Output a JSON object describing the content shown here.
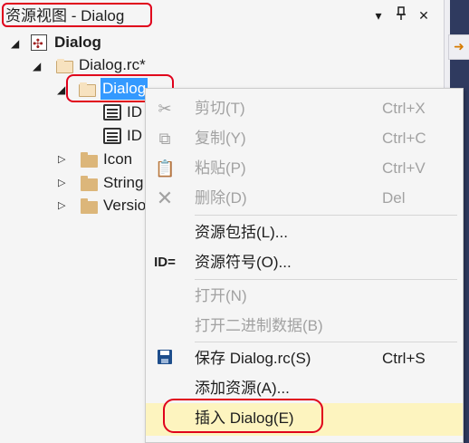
{
  "window": {
    "title": "资源视图 - Dialog"
  },
  "title_buttons": {
    "dropdown": "▾",
    "pin": "📌",
    "close": "✕"
  },
  "tree": {
    "root": {
      "label": "Dialog"
    },
    "rc_file": {
      "label": "Dialog.rc*"
    },
    "dialog_folder": {
      "label": "Dialog"
    },
    "dialog_items": [
      {
        "label": "ID"
      },
      {
        "label": "ID"
      }
    ],
    "icon_folder": {
      "label": "Icon"
    },
    "string_folder": {
      "label": "String"
    },
    "version_folder": {
      "label": "Versio"
    }
  },
  "context_menu": {
    "cut": {
      "label": "剪切(T)",
      "shortcut": "Ctrl+X",
      "icon": "scissors-icon"
    },
    "copy": {
      "label": "复制(Y)",
      "shortcut": "Ctrl+C",
      "icon": "copy-icon"
    },
    "paste": {
      "label": "粘贴(P)",
      "shortcut": "Ctrl+V",
      "icon": "paste-icon"
    },
    "delete": {
      "label": "删除(D)",
      "shortcut": "Del",
      "icon": "delete-icon"
    },
    "resource_includes": {
      "label": "资源包括(L)..."
    },
    "resource_symbols": {
      "label": "资源符号(O)...",
      "icon_text": "ID="
    },
    "open": {
      "label": "打开(N)"
    },
    "open_binary": {
      "label": "打开二进制数据(B)"
    },
    "save": {
      "label": "保存 Dialog.rc(S)",
      "shortcut": "Ctrl+S",
      "icon": "save-icon"
    },
    "add_resource": {
      "label": "添加资源(A)..."
    },
    "insert_dialog": {
      "label": "插入 Dialog(E)"
    }
  },
  "colors": {
    "accent": "#3399ff",
    "highlight_ring": "#e0001b",
    "hover": "#fdf4bf",
    "disabled_text": "#a2a2a2"
  }
}
